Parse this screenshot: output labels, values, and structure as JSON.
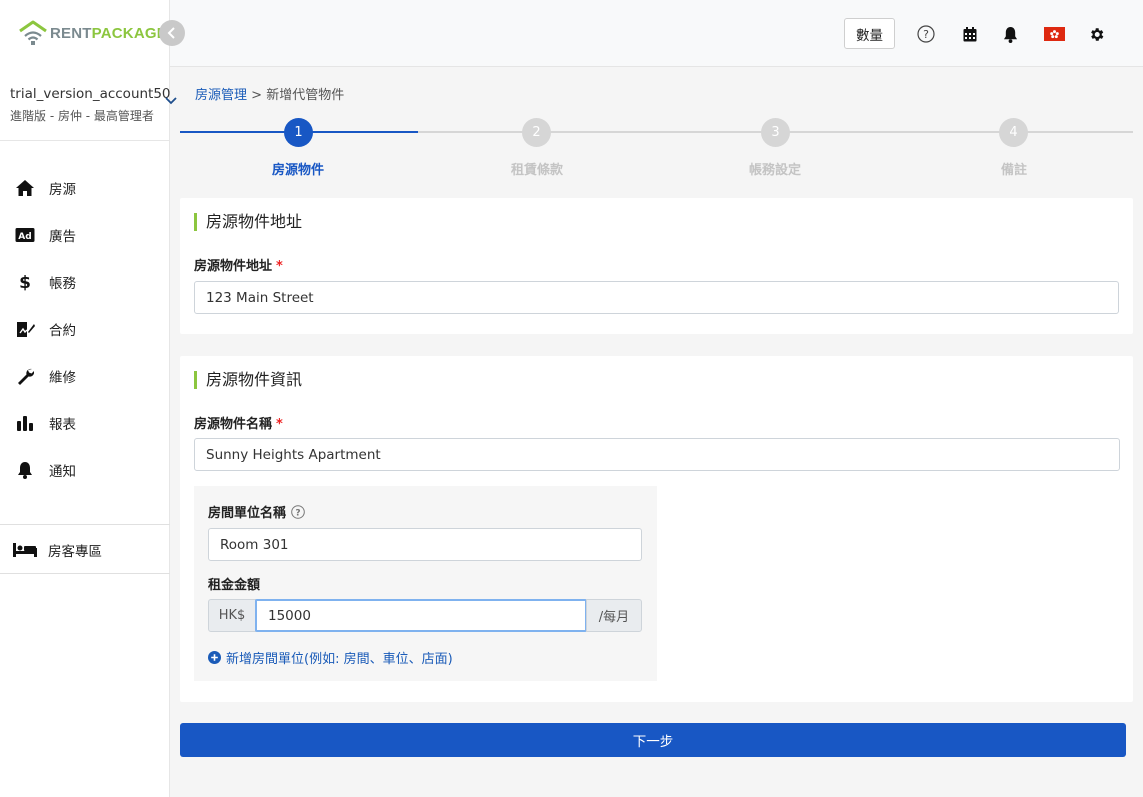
{
  "brand": {
    "name_part1": "RENT",
    "name_part2": "PACKAGE"
  },
  "account": {
    "username": "trial_version_account50",
    "role": "進階版 - 房仲 - 最高管理者"
  },
  "sidebar": {
    "items": [
      {
        "label": "房源",
        "icon": "home-icon"
      },
      {
        "label": "廣告",
        "icon": "ad-icon"
      },
      {
        "label": "帳務",
        "icon": "dollar-icon"
      },
      {
        "label": "合約",
        "icon": "contract-icon"
      },
      {
        "label": "維修",
        "icon": "wrench-icon"
      },
      {
        "label": "報表",
        "icon": "chart-icon"
      },
      {
        "label": "通知",
        "icon": "bell-icon"
      }
    ],
    "tenant_area": {
      "label": "房客專區",
      "icon": "bed-icon"
    }
  },
  "topbar": {
    "quantity_label": "數量",
    "icons": [
      "help-icon",
      "calendar-icon",
      "bell-icon",
      "hong-kong-flag-icon",
      "gear-icon"
    ]
  },
  "breadcrumb": {
    "parent": "房源管理",
    "separator": ">",
    "current": "新增代管物件"
  },
  "stepper": {
    "active_step": 1,
    "steps": [
      {
        "number": "1",
        "label": "房源物件"
      },
      {
        "number": "2",
        "label": "租賃條款"
      },
      {
        "number": "3",
        "label": "帳務設定"
      },
      {
        "number": "4",
        "label": "備註"
      }
    ]
  },
  "address_section": {
    "title": "房源物件地址",
    "field_label": "房源物件地址",
    "required_mark": "*",
    "value": "123 Main Street"
  },
  "info_section": {
    "title": "房源物件資訊",
    "name_label": "房源物件名稱",
    "required_mark": "*",
    "name_value": "Sunny Heights Apartment",
    "unit": {
      "unit_name_label": "房間單位名稱",
      "unit_name_value": "Room 301",
      "rent_label": "租金金額",
      "currency": "HK$",
      "rent_value": "15000",
      "period": "/每月"
    },
    "add_unit_label": "新增房間單位(例如: 房間、車位、店面)"
  },
  "next_button": "下一步",
  "colors": {
    "primary": "#1857c4",
    "accent_green": "#8cc63f",
    "inactive_step": "#d6d6d6",
    "required": "#e22222"
  }
}
